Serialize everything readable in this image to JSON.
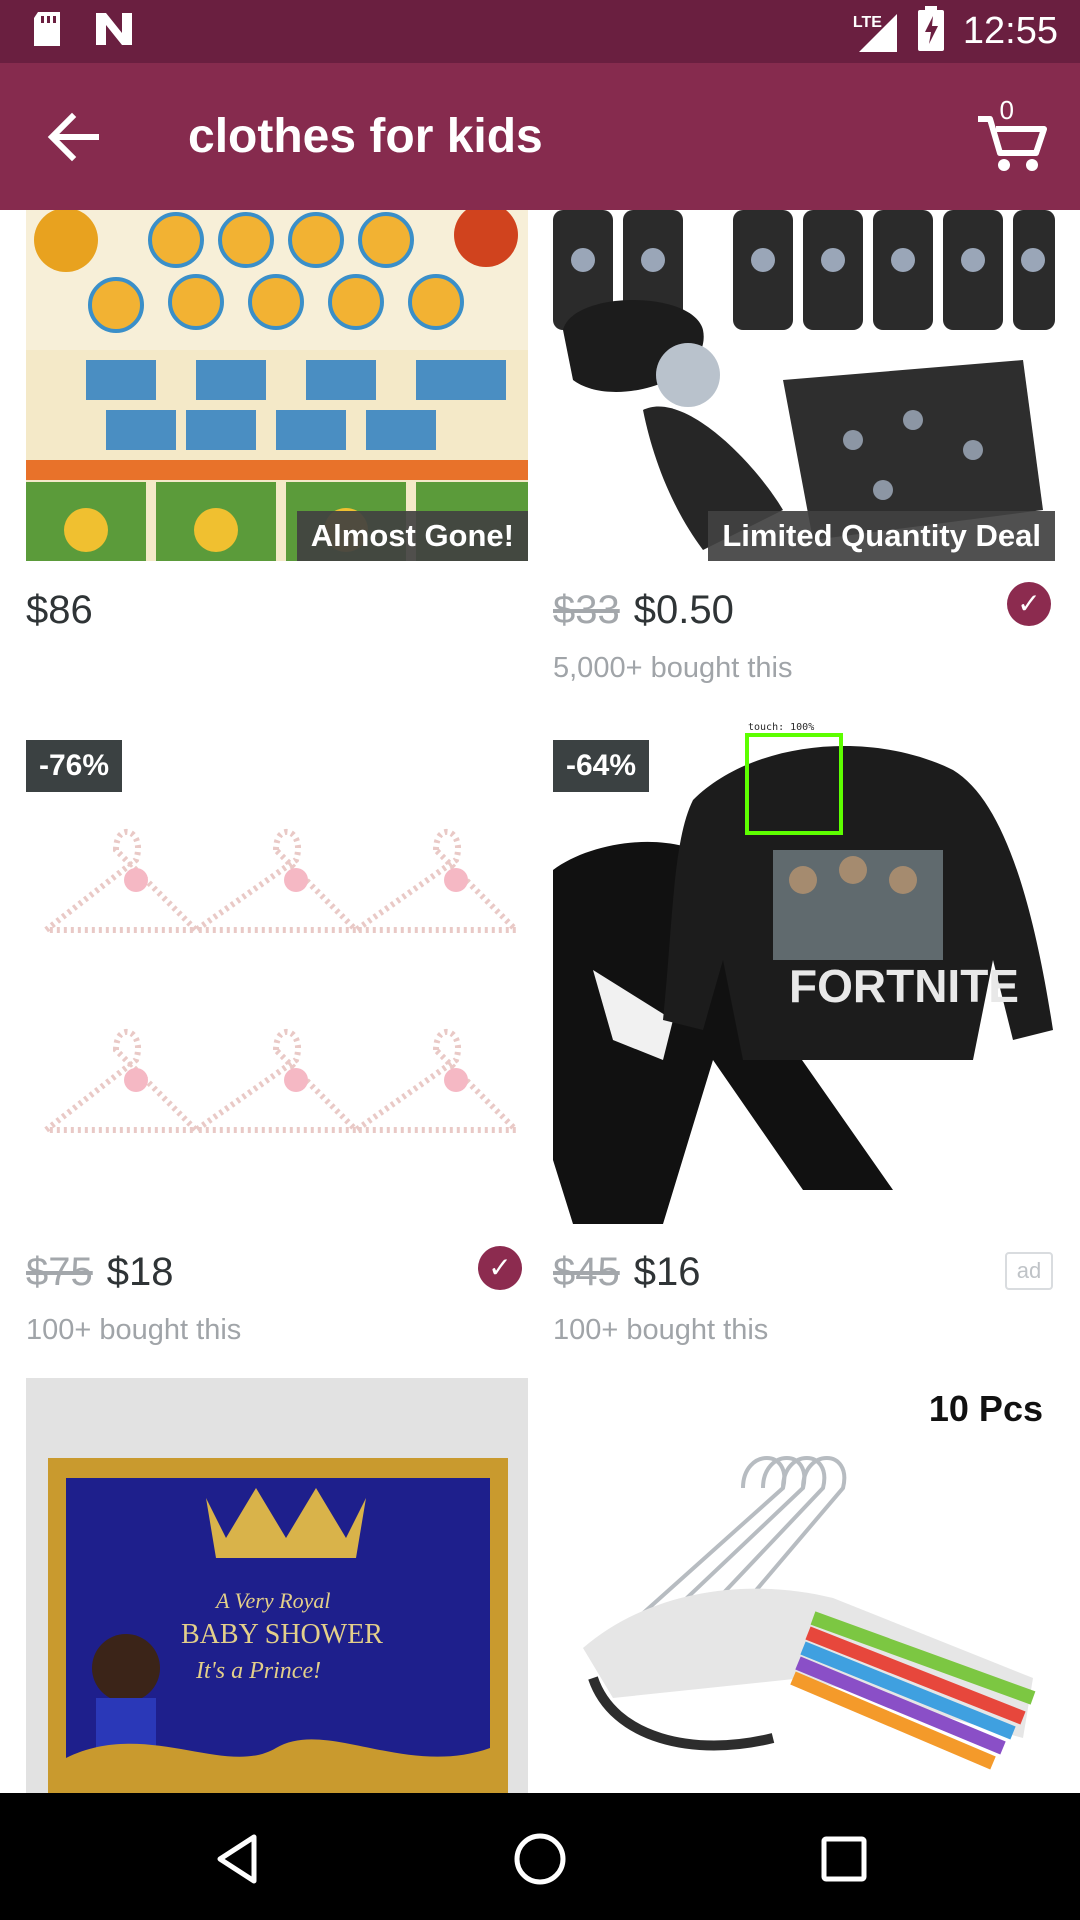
{
  "status_bar": {
    "network_label": "LTE",
    "time": "12:55",
    "icons": [
      "sd-card-icon",
      "n-logo-icon",
      "signal-icon",
      "battery-charging-icon"
    ]
  },
  "app_bar": {
    "title": "clothes for kids",
    "cart_count": "0",
    "back_icon": "arrow-back-icon",
    "cart_icon": "shopping-cart-icon"
  },
  "products": [
    {
      "banner": "Almost Gone!",
      "price": "$86",
      "image": "winnie-the-pooh-party-supplies"
    },
    {
      "banner": "Limited Quantity Deal",
      "old_price": "$33",
      "price": "$0.50",
      "bought": "5,000+ bought this",
      "verified": true,
      "image": "black-paw-print-bag-set"
    },
    {
      "discount": "-76%",
      "old_price": "$75",
      "price": "$18",
      "bought": "100+ bought this",
      "verified": true,
      "image": "pink-pearl-hangers"
    },
    {
      "discount": "-64%",
      "old_price": "$45",
      "price": "$16",
      "bought": "100+ bought this",
      "ad_label": "ad",
      "image": "fortnite-hoodie-set"
    },
    {
      "image": "royal-baby-shower-banner",
      "image_text": [
        "A Very Royal",
        "BABY SHOWER",
        "It's a Prince!"
      ]
    },
    {
      "image": "colorful-kids-hangers",
      "corner_text": "10 Pcs"
    }
  ],
  "touch_overlay": {
    "label": "touch: 100%"
  },
  "nav_bar": {
    "icons": [
      "back-triangle-icon",
      "home-circle-icon",
      "recents-square-icon"
    ]
  },
  "colors": {
    "status_bar": "#6a1f40",
    "app_bar": "#862b4e",
    "verified_badge": "#8c2b4f",
    "touch_box": "#5dff00"
  }
}
